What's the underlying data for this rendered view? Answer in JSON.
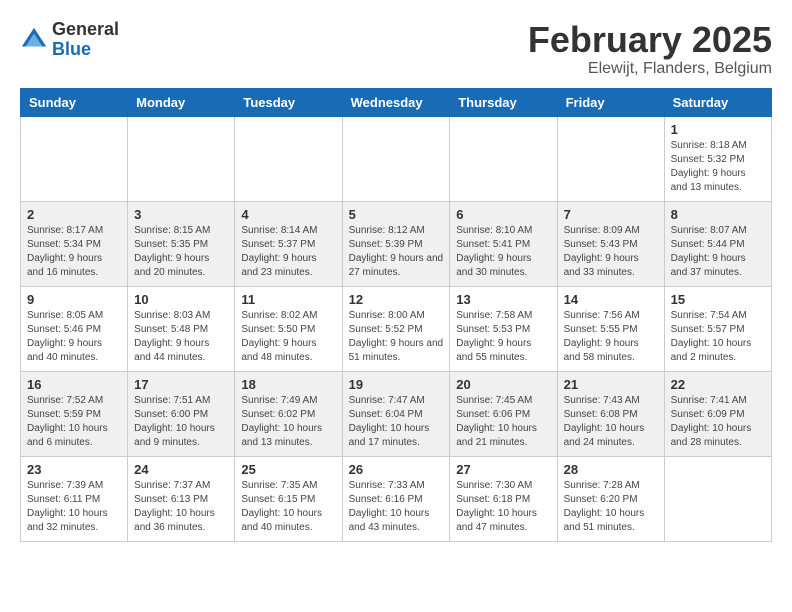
{
  "header": {
    "logo_line1": "General",
    "logo_line2": "Blue",
    "title": "February 2025",
    "subtitle": "Elewijt, Flanders, Belgium"
  },
  "weekdays": [
    "Sunday",
    "Monday",
    "Tuesday",
    "Wednesday",
    "Thursday",
    "Friday",
    "Saturday"
  ],
  "weeks": [
    [
      {
        "day": "",
        "info": ""
      },
      {
        "day": "",
        "info": ""
      },
      {
        "day": "",
        "info": ""
      },
      {
        "day": "",
        "info": ""
      },
      {
        "day": "",
        "info": ""
      },
      {
        "day": "",
        "info": ""
      },
      {
        "day": "1",
        "info": "Sunrise: 8:18 AM\nSunset: 5:32 PM\nDaylight: 9 hours and 13 minutes."
      }
    ],
    [
      {
        "day": "2",
        "info": "Sunrise: 8:17 AM\nSunset: 5:34 PM\nDaylight: 9 hours and 16 minutes."
      },
      {
        "day": "3",
        "info": "Sunrise: 8:15 AM\nSunset: 5:35 PM\nDaylight: 9 hours and 20 minutes."
      },
      {
        "day": "4",
        "info": "Sunrise: 8:14 AM\nSunset: 5:37 PM\nDaylight: 9 hours and 23 minutes."
      },
      {
        "day": "5",
        "info": "Sunrise: 8:12 AM\nSunset: 5:39 PM\nDaylight: 9 hours and 27 minutes."
      },
      {
        "day": "6",
        "info": "Sunrise: 8:10 AM\nSunset: 5:41 PM\nDaylight: 9 hours and 30 minutes."
      },
      {
        "day": "7",
        "info": "Sunrise: 8:09 AM\nSunset: 5:43 PM\nDaylight: 9 hours and 33 minutes."
      },
      {
        "day": "8",
        "info": "Sunrise: 8:07 AM\nSunset: 5:44 PM\nDaylight: 9 hours and 37 minutes."
      }
    ],
    [
      {
        "day": "9",
        "info": "Sunrise: 8:05 AM\nSunset: 5:46 PM\nDaylight: 9 hours and 40 minutes."
      },
      {
        "day": "10",
        "info": "Sunrise: 8:03 AM\nSunset: 5:48 PM\nDaylight: 9 hours and 44 minutes."
      },
      {
        "day": "11",
        "info": "Sunrise: 8:02 AM\nSunset: 5:50 PM\nDaylight: 9 hours and 48 minutes."
      },
      {
        "day": "12",
        "info": "Sunrise: 8:00 AM\nSunset: 5:52 PM\nDaylight: 9 hours and 51 minutes."
      },
      {
        "day": "13",
        "info": "Sunrise: 7:58 AM\nSunset: 5:53 PM\nDaylight: 9 hours and 55 minutes."
      },
      {
        "day": "14",
        "info": "Sunrise: 7:56 AM\nSunset: 5:55 PM\nDaylight: 9 hours and 58 minutes."
      },
      {
        "day": "15",
        "info": "Sunrise: 7:54 AM\nSunset: 5:57 PM\nDaylight: 10 hours and 2 minutes."
      }
    ],
    [
      {
        "day": "16",
        "info": "Sunrise: 7:52 AM\nSunset: 5:59 PM\nDaylight: 10 hours and 6 minutes."
      },
      {
        "day": "17",
        "info": "Sunrise: 7:51 AM\nSunset: 6:00 PM\nDaylight: 10 hours and 9 minutes."
      },
      {
        "day": "18",
        "info": "Sunrise: 7:49 AM\nSunset: 6:02 PM\nDaylight: 10 hours and 13 minutes."
      },
      {
        "day": "19",
        "info": "Sunrise: 7:47 AM\nSunset: 6:04 PM\nDaylight: 10 hours and 17 minutes."
      },
      {
        "day": "20",
        "info": "Sunrise: 7:45 AM\nSunset: 6:06 PM\nDaylight: 10 hours and 21 minutes."
      },
      {
        "day": "21",
        "info": "Sunrise: 7:43 AM\nSunset: 6:08 PM\nDaylight: 10 hours and 24 minutes."
      },
      {
        "day": "22",
        "info": "Sunrise: 7:41 AM\nSunset: 6:09 PM\nDaylight: 10 hours and 28 minutes."
      }
    ],
    [
      {
        "day": "23",
        "info": "Sunrise: 7:39 AM\nSunset: 6:11 PM\nDaylight: 10 hours and 32 minutes."
      },
      {
        "day": "24",
        "info": "Sunrise: 7:37 AM\nSunset: 6:13 PM\nDaylight: 10 hours and 36 minutes."
      },
      {
        "day": "25",
        "info": "Sunrise: 7:35 AM\nSunset: 6:15 PM\nDaylight: 10 hours and 40 minutes."
      },
      {
        "day": "26",
        "info": "Sunrise: 7:33 AM\nSunset: 6:16 PM\nDaylight: 10 hours and 43 minutes."
      },
      {
        "day": "27",
        "info": "Sunrise: 7:30 AM\nSunset: 6:18 PM\nDaylight: 10 hours and 47 minutes."
      },
      {
        "day": "28",
        "info": "Sunrise: 7:28 AM\nSunset: 6:20 PM\nDaylight: 10 hours and 51 minutes."
      },
      {
        "day": "",
        "info": ""
      }
    ]
  ]
}
